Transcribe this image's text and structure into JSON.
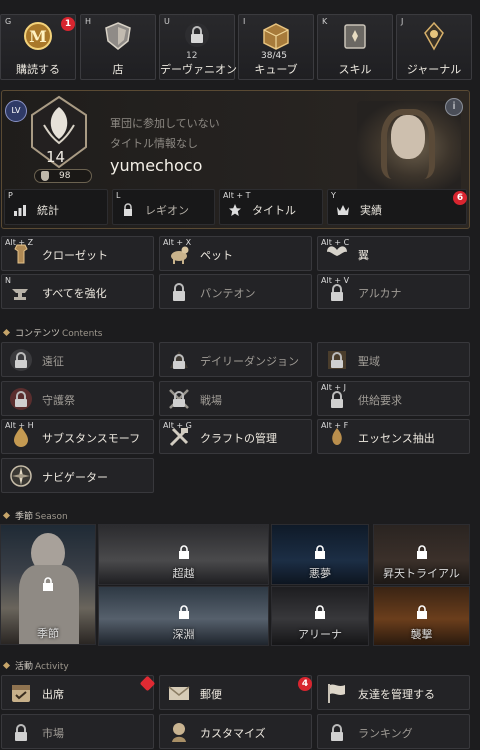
{
  "top_buttons": [
    {
      "key": "G",
      "label": "購読する",
      "badge": "1",
      "icon": "subscription-medallion-icon"
    },
    {
      "key": "H",
      "label": "店",
      "icon": "shop-shield-icon"
    },
    {
      "key": "U",
      "label": "デーヴァニオン",
      "sub": "12",
      "icon": "daevanion-lock-icon"
    },
    {
      "key": "I",
      "label": "キューブ",
      "sub": "38/45",
      "icon": "cube-icon"
    },
    {
      "key": "K",
      "label": "スキル",
      "icon": "skill-book-icon"
    },
    {
      "key": "J",
      "label": "ジャーナル",
      "icon": "journal-emblem-icon"
    }
  ],
  "profile": {
    "level_tag": "LV",
    "level": "14",
    "sub_value": "98",
    "legion_status": "軍団に参加していない",
    "title_status": "タイトル情報なし",
    "name": "yumechoco",
    "info": "i"
  },
  "profile_buttons": [
    {
      "key": "P",
      "label": "統計",
      "icon": "stats-icon"
    },
    {
      "key": "L",
      "label": "レギオン",
      "icon": "legion-lock-icon"
    },
    {
      "key": "Alt + T",
      "label": "タイトル",
      "icon": "title-star-icon"
    },
    {
      "key": "Y",
      "label": "実績",
      "icon": "achievement-crown-icon",
      "badge": "6"
    }
  ],
  "menu_tiles": [
    {
      "key": "Alt + Z",
      "label": "クローゼット",
      "icon": "closet-icon"
    },
    {
      "key": "Alt + X",
      "label": "ペット",
      "icon": "pet-icon"
    },
    {
      "key": "Alt + C",
      "label": "翼",
      "icon": "wings-icon"
    },
    {
      "key": "N",
      "label": "すべてを強化",
      "icon": "enhance-anvil-icon"
    },
    {
      "key": "",
      "label": "パンテオン",
      "icon": "pantheon-lock-icon",
      "dim": true
    },
    {
      "key": "Alt + V",
      "label": "アルカナ",
      "icon": "arcana-lock-icon",
      "dim": true
    }
  ],
  "contents_section": {
    "title": "コンテンツ",
    "subtitle": "Contents"
  },
  "contents_tiles": [
    {
      "key": "",
      "label": "遠征",
      "icon": "expedition-lock-icon",
      "dim": true
    },
    {
      "key": "",
      "label": "デイリーダンジョン",
      "icon": "daily-dungeon-lock-icon",
      "dim": true
    },
    {
      "key": "",
      "label": "聖域",
      "icon": "sanctuary-lock-icon",
      "dim": true
    },
    {
      "key": "",
      "label": "守護祭",
      "icon": "guardian-festival-lock-icon",
      "dim": true
    },
    {
      "key": "",
      "label": "戦場",
      "icon": "battlefield-lock-icon",
      "dim": true
    },
    {
      "key": "Alt + J",
      "label": "供給要求",
      "icon": "supply-request-lock-icon",
      "dim": true
    },
    {
      "key": "Alt + H",
      "label": "サブスタンスモーフ",
      "icon": "substance-morph-icon"
    },
    {
      "key": "Alt + G",
      "label": "クラフトの管理",
      "icon": "crafting-tools-icon"
    },
    {
      "key": "Alt + F",
      "label": "エッセンス抽出",
      "icon": "essence-extraction-icon"
    },
    {
      "key": "",
      "label": "ナビゲーター",
      "icon": "navigator-compass-icon"
    }
  ],
  "season_section": {
    "title": "季節",
    "subtitle": "Season"
  },
  "season_cards": [
    {
      "label": "季節",
      "locked": true
    },
    {
      "label": "超越",
      "locked": true
    },
    {
      "label": "悪夢",
      "locked": true
    },
    {
      "label": "昇天トライアル",
      "locked": true
    },
    {
      "label": "深淵",
      "locked": true
    },
    {
      "label": "アリーナ",
      "locked": true
    },
    {
      "label": "襲撃",
      "locked": true
    }
  ],
  "activity_section": {
    "title": "活動",
    "subtitle": "Activity"
  },
  "activity_tiles": [
    {
      "key": "",
      "label": "出席",
      "icon": "attendance-icon",
      "diamond": true
    },
    {
      "key": "",
      "label": "郵便",
      "icon": "mail-icon",
      "badge": "4"
    },
    {
      "key": "",
      "label": "友達を管理する",
      "icon": "friends-flag-icon"
    },
    {
      "key": "",
      "label": "市場",
      "icon": "market-lock-icon",
      "dim": true
    },
    {
      "key": "",
      "label": "カスタマイズ",
      "icon": "customize-icon"
    },
    {
      "key": "",
      "label": "ランキング",
      "icon": "ranking-lock-icon",
      "dim": true
    }
  ],
  "colors": {
    "accent_gold": "#c6a56a",
    "badge_red": "#d8252f",
    "panel_border": "#5a4a33"
  }
}
